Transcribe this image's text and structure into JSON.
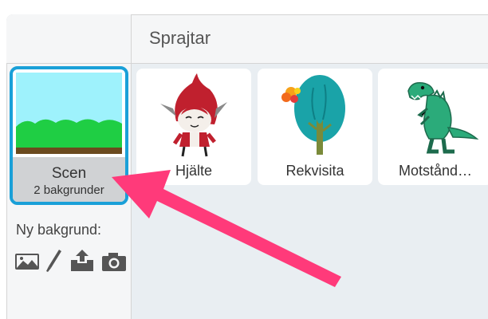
{
  "header": {
    "title": "Sprajtar"
  },
  "stage": {
    "name": "Scen",
    "backdrop_count": "2 bakgrunder"
  },
  "new_backdrop": {
    "label": "Ny bakgrund:",
    "tools": [
      "image-library-icon",
      "paintbrush-icon",
      "upload-icon",
      "camera-icon"
    ]
  },
  "sprites": [
    {
      "label": "Hjälte",
      "icon": "red-hooded-hero-sprite"
    },
    {
      "label": "Rekvisita",
      "icon": "tree-sprite"
    },
    {
      "label": "Motstånd…",
      "icon": "green-dinosaur-sprite"
    }
  ],
  "annotation": {
    "color": "#ff3a7a",
    "points_to": "stage-tile"
  }
}
